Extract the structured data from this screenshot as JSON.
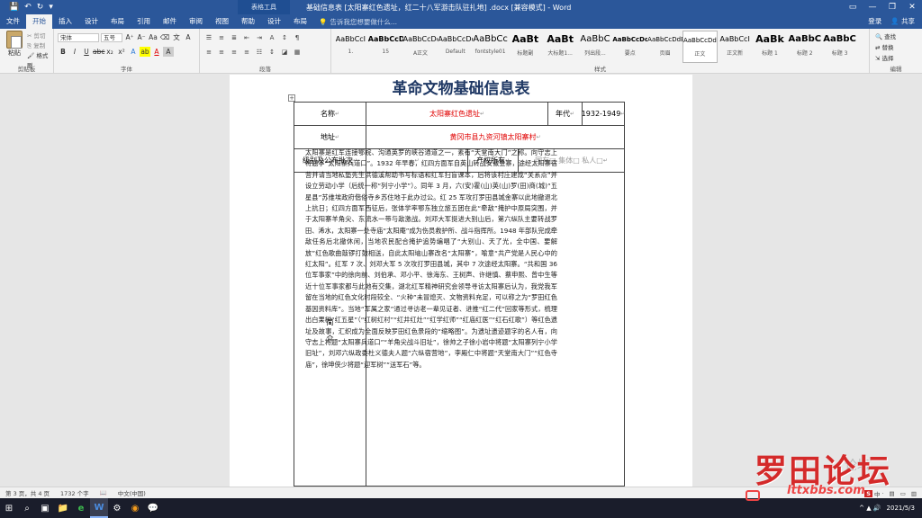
{
  "titlebar": {
    "qat": [
      "💾",
      "↶",
      "↻",
      "▾"
    ],
    "context_tab": "表格工具",
    "title": "基础信息表 [太阳寨红色遗址，红二十八军游击队驻扎地] .docx [兼容模式] - Word",
    "window_buttons": [
      "▭",
      "—",
      "❐",
      "✕"
    ]
  },
  "tabs": [
    "文件",
    "开始",
    "插入",
    "设计",
    "布局",
    "引用",
    "邮件",
    "审阅",
    "视图",
    "帮助",
    "设计",
    "布局"
  ],
  "tell_me": "告诉我您想要做什么...",
  "account": {
    "login": "登录",
    "share": "共享"
  },
  "ribbon": {
    "clipboard": {
      "paste": "粘贴",
      "cut": "剪切",
      "copy": "复制",
      "format_painter": "格式刷",
      "label": "剪贴板"
    },
    "font": {
      "name": "宋体",
      "size": "五号",
      "label": "字体"
    },
    "paragraph": {
      "label": "段落"
    },
    "styles": {
      "label": "样式",
      "items": [
        {
          "sample": "AaBbCcI",
          "name": "1."
        },
        {
          "sample": "AaBbCcD",
          "name": "15"
        },
        {
          "sample": "AaBbCcDc",
          "name": "A正文"
        },
        {
          "sample": "AaBbCcDc",
          "name": "Default"
        },
        {
          "sample": "AaBbCc",
          "name": "fontstyle01"
        },
        {
          "sample": "AaBt",
          "name": "标题副"
        },
        {
          "sample": "AaBt",
          "name": "大标题1..."
        },
        {
          "sample": "AaBbC",
          "name": "列出段..."
        },
        {
          "sample": "AaBbCcDd",
          "name": "要点"
        },
        {
          "sample": "AaBbCcDdE",
          "name": "页眉"
        },
        {
          "sample": "AaBbCcDd",
          "name": "正文"
        },
        {
          "sample": "AaBbCcI",
          "name": "正文新"
        },
        {
          "sample": "AaBk",
          "name": "标题 1"
        },
        {
          "sample": "AaBbC",
          "name": "标题 2"
        },
        {
          "sample": "AaBbC",
          "name": "标题 3"
        }
      ]
    },
    "editing": {
      "find": "查找",
      "replace": "替换",
      "select": "选择",
      "label": "编辑"
    }
  },
  "document": {
    "title": "革命文物基础信息表",
    "row1": {
      "name_label": "名称",
      "name_value": "太阳寨红色遗址",
      "era_label": "年代",
      "era_value": "1932-1949"
    },
    "row2": {
      "address_label": "地址",
      "address_value": "黄冈市县九资河镇太阳寨村"
    },
    "row3": {
      "level_label": "级别及公布批次",
      "ownership_label": "产权所有",
      "owner_options": "国有□ 集体□ 私人□"
    },
    "intro_label_1": "简",
    "intro_label_2": "介",
    "intro_text": "太阳寨是红军连接鄂皖、沟通英罗的峡谷通道之一，素有“天堂南大门”之称。向守志上将题字“太阳寨兵道口”。1932 年早春，红四方面军自英山转战安徽金寨，途经太阳寨宿营并请当地私塾先生洪德溪帮助书写标语和红军扫盲课本，后将该村庄建成“关系点”并设立劳动小学（后统一称“列宁小学”）。同年 3 月，六(安)霍(山)英(山)罗(田)商(城)“五星县”苏维埃政府偕俗寺乡苏住地于此办过公。红 25 军攻打罗田县城金寨以此地撤退北上抗日；红四方面军西征后，张体学率鄂东独立旅五团在此“牵敌”掩护中原局突围，并于太阳寨羊角尖、东流水一带与敌激战。刘邓大军挺进大别山后，第六纵队主要转战罗田、浠水，太阳寨一处寺庙“太阳庵”成为伤员救护所、战斗指挥所。1948 年部队完成牵敌任务后北撤休闲，当地农民配合掩护追势编唱了“大别山、天了光，全中国、要解放”红色歌曲敲锣打鼓相送，自此太阳垴山寨改名“太阳寨”，喻意“共产党是人民心中的红太阳”。红军 7 次、刘邓大军 5 次攻打罗田县城，其中 7 次途经太阳寨。“共和国 36 位军事家”中的徐向前、刘伯承、邓小平、徐海东、王树声、许继慎、蔡申熙、曾中生等近十位军事家都与此地有交集，湖北红军精神研究会领导寻访太阳寨后认为，我党我军留在当地的红色文化时段较全、“火种”未冒熄灭、文物资料充足，可以称之为“罗田红色基因资料库”。当地“军属之家”通过寻访老一辈见证者、进推“红二代”回家等形式，梳理出白果树“红五星”（“红树红村”“红井红灶”“红学红师”“红庙红医”“红石红歌”）等红色遗址及故事，汇织成为全面反映罗田红色景段的“缩略图”。为遗址遗迹题字的名人有，向守志上将题“太阳寨兵道口”“羊角尖战斗旧址”，徐帅之子徐小岩中将题“太阳寨列宁小学旧址”，刘邓六纵政委杜义德夫人题“六纵宿营地”，李殿仁中将题“天堂南大门”“红色寺庙”，徐坤侠少将题“迎军树”“送军石”等。"
  },
  "status": {
    "page": "第 3 页，共 4 页",
    "words": "1732 个字",
    "lang": "中文(中国)"
  },
  "ime": {
    "badge": "S",
    "zh": "中",
    "mode": "·"
  },
  "taskbar": {
    "icons": [
      "⊞",
      "⌕",
      "▣",
      "📁",
      "e",
      "W",
      "⚙",
      "◉",
      "💬"
    ],
    "clock": "2021/5/3"
  },
  "watermark": {
    "main": "罗田论坛",
    "sub": "lttxbbs.com",
    "author": "论坛"
  }
}
